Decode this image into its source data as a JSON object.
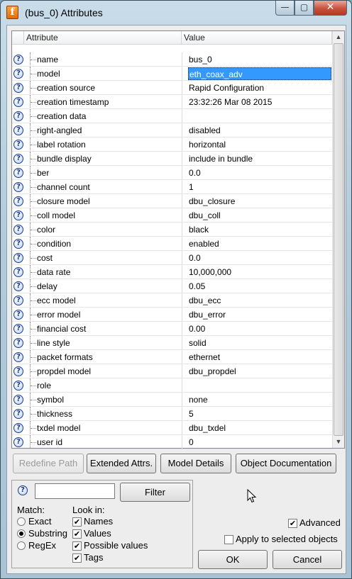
{
  "window": {
    "title": "(bus_0) Attributes",
    "app_icon_glyph": "f",
    "minimize_glyph": "—",
    "maximize_glyph": "▢",
    "close_glyph": "✕"
  },
  "table": {
    "columns": {
      "attribute": "Attribute",
      "value": "Value"
    },
    "rows": [
      {
        "name": "name",
        "value": "bus_0"
      },
      {
        "name": "model",
        "value": "eth_coax_adv",
        "selected": true
      },
      {
        "name": "creation source",
        "value": "Rapid Configuration"
      },
      {
        "name": "creation timestamp",
        "value": "23:32:26 Mar 08 2015"
      },
      {
        "name": "creation data",
        "value": ""
      },
      {
        "name": "right-angled",
        "value": "disabled"
      },
      {
        "name": "label rotation",
        "value": "horizontal"
      },
      {
        "name": "bundle display",
        "value": "include in bundle"
      },
      {
        "name": "ber",
        "value": "0.0"
      },
      {
        "name": "channel count",
        "value": "1"
      },
      {
        "name": "closure model",
        "value": "dbu_closure"
      },
      {
        "name": "coll model",
        "value": "dbu_coll"
      },
      {
        "name": "color",
        "value": "black"
      },
      {
        "name": "condition",
        "value": "enabled"
      },
      {
        "name": "cost",
        "value": "0.0"
      },
      {
        "name": "data rate",
        "value": "10,000,000"
      },
      {
        "name": "delay",
        "value": "0.05"
      },
      {
        "name": "ecc model",
        "value": "dbu_ecc"
      },
      {
        "name": "error model",
        "value": "dbu_error"
      },
      {
        "name": "financial cost",
        "value": "0.00"
      },
      {
        "name": "line style",
        "value": "solid"
      },
      {
        "name": "packet formats",
        "value": "ethernet"
      },
      {
        "name": "propdel model",
        "value": "dbu_propdel"
      },
      {
        "name": "role",
        "value": ""
      },
      {
        "name": "symbol",
        "value": "none"
      },
      {
        "name": "thickness",
        "value": "5"
      },
      {
        "name": "txdel model",
        "value": "dbu_txdel"
      },
      {
        "name": "user id",
        "value": "0"
      }
    ],
    "row_help_glyph": "?"
  },
  "buttons": {
    "redefine_path": "Redefine Path",
    "extended_attrs": "Extended Attrs.",
    "model_details": "Model Details",
    "object_documentation": "Object Documentation",
    "filter": "Filter",
    "ok": "OK",
    "cancel": "Cancel"
  },
  "filter": {
    "search_value": "",
    "help_glyph": "?",
    "match_label": "Match:",
    "match_options": [
      {
        "label": "Exact",
        "selected": false
      },
      {
        "label": "Substring",
        "selected": true
      },
      {
        "label": "RegEx",
        "selected": false
      }
    ],
    "lookin_label": "Look in:",
    "lookin_options": [
      {
        "label": "Names",
        "checked": true
      },
      {
        "label": "Values",
        "checked": true
      },
      {
        "label": "Possible values",
        "checked": true
      },
      {
        "label": "Tags",
        "checked": true
      }
    ]
  },
  "options": {
    "advanced": {
      "label": "Advanced",
      "checked": true
    },
    "apply_to_selected": {
      "label": "Apply to selected objects",
      "checked": false
    }
  },
  "check_glyph": "✔"
}
